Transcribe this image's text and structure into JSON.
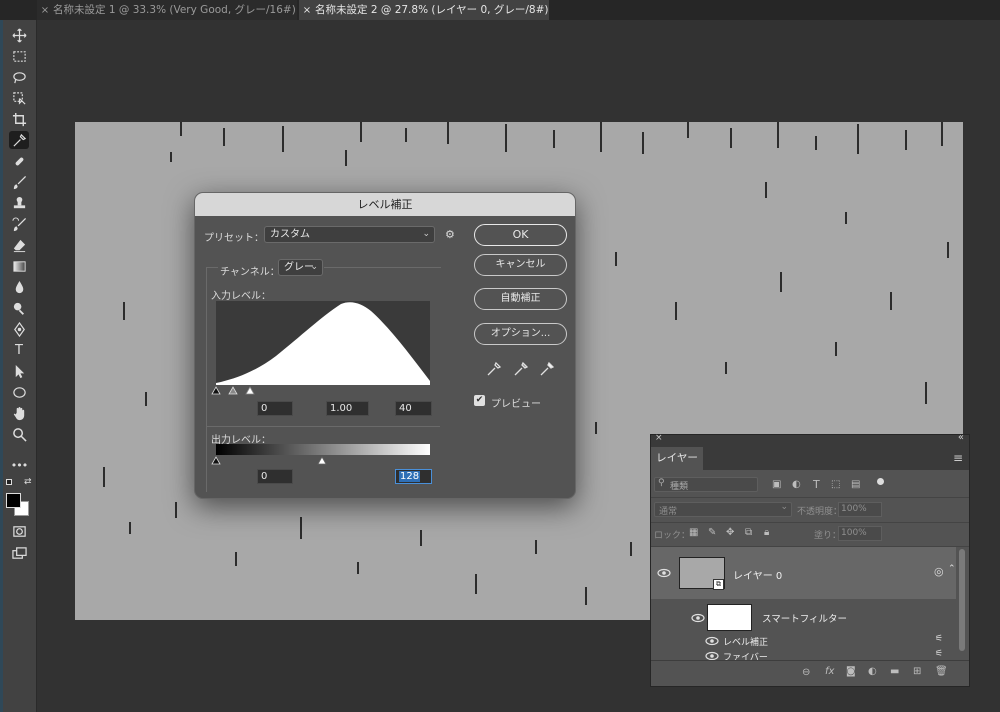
{
  "tabs": [
    {
      "label": "名称未設定 1 @ 33.3% (Very Good, グレー/16#) *",
      "active": false
    },
    {
      "label": "名称未設定 2 @ 27.8% (レイヤー 0, グレー/8#) *",
      "active": true
    }
  ],
  "tab_close_glyph": "×",
  "toolbar": {
    "tools": [
      "move-icon",
      "marquee-icon",
      "lasso-icon",
      "object-select-icon",
      "crop-icon",
      "eyedropper-icon",
      "healing-icon",
      "brush-icon",
      "stamp-icon",
      "history-brush-icon",
      "eraser-icon",
      "gradient-icon",
      "blur-icon",
      "dodge-icon",
      "pen-icon",
      "type-icon",
      "path-select-icon",
      "shape-icon",
      "hand-icon",
      "zoom-icon",
      "more-icon",
      "color-swatches",
      "quick-mask-icon",
      "screen-mode-icon"
    ],
    "type_glyph": "T",
    "more_glyph": "•••"
  },
  "levels": {
    "title": "レベル補正",
    "preset_label": "プリセット：",
    "preset_value": "カスタム",
    "channel_label": "チャンネル：",
    "channel_value": "グレー",
    "input_label": "入力レベル：",
    "input_values": [
      "0",
      "1.00",
      "40"
    ],
    "output_label": "出力レベル：",
    "output_values": [
      "0",
      "128"
    ],
    "buttons": {
      "ok": "OK",
      "cancel": "キャンセル",
      "auto": "自動補正",
      "options": "オプション..."
    },
    "preview_label": "プレビュー",
    "preview_checked": true,
    "histogram_shape": "bell curve peaking near 55% of range"
  },
  "layers_panel": {
    "tab_label": "レイヤー",
    "search_placeholder": "種類",
    "blend_mode": "通常",
    "opacity_label": "不透明度：",
    "opacity_value": "100%",
    "lock_label": "ロック：",
    "fill_label": "塗り：",
    "fill_value": "100%",
    "layer_name": "レイヤー 0",
    "smart_filter_label": "スマートフィルター",
    "filters": [
      "レベル補正",
      "ファイバー"
    ],
    "collapse_glyph": "«",
    "close_glyph": "×",
    "menu_glyph": "≡"
  },
  "colors": {
    "accent": "#4a90d9",
    "canvas_gray": "#a8a8a8",
    "panel": "#535353"
  }
}
